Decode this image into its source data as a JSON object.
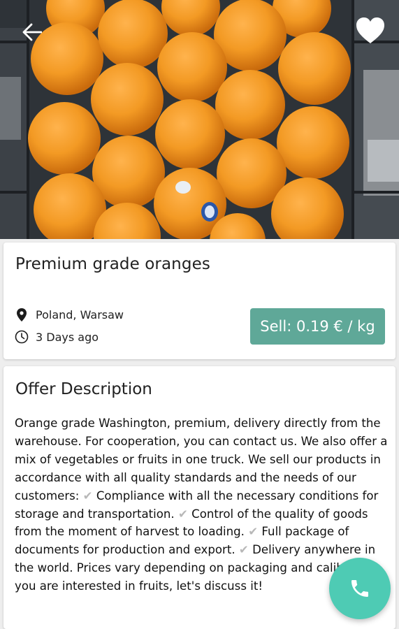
{
  "product": {
    "title": "Premium grade oranges",
    "location": "Poland, Warsaw",
    "posted": "3 Days ago",
    "price_label": "Sell: 0.19 € / kg"
  },
  "description": {
    "heading": "Offer Description",
    "text_1": "Orange grade Washington, premium, delivery directly from the warehouse. For cooperation, you can contact us. We also offer a mix of vegetables or fruits in one truck. We sell our products in accordance with all quality standards and the needs of our customers: ",
    "text_2": "Compliance with all the necessary conditions for storage and transportation. ",
    "text_3": " Control of the quality of goods from the moment of harvest to loading. ",
    "text_4": "Full package of documents for production and export. ",
    "text_5": "Delivery anywhere in the world. Prices vary depending on packaging and calibers. If you are interested in fruits, let's discuss it!",
    "check_mark": "✔"
  },
  "icons": {
    "back": "arrow-left-icon",
    "favorite": "heart-icon",
    "location": "map-pin-icon",
    "time": "clock-icon",
    "call": "phone-icon"
  },
  "colors": {
    "price_badge": "#5fa898",
    "fab": "#4ecbb4",
    "check": "#b8b8b8"
  }
}
